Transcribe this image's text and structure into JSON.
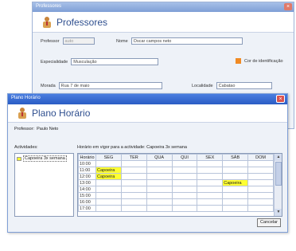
{
  "back_window": {
    "title": "Professores",
    "header_title": "Professores",
    "fields": {
      "professor_label": "Professor",
      "professor_value": "auto",
      "nome_label": "Nome",
      "nome_value": "Oscar campos neto",
      "especialidade_label": "Especialidade",
      "especialidade_value": "Musculação",
      "cor_label": "Cor de identificação",
      "morada_label": "Morada",
      "morada_value": "Rua 7 de maio",
      "localidade_label": "Localidade",
      "localidade_value": "Cabatao"
    },
    "colors": {
      "identification": "#f08a24"
    }
  },
  "front_window": {
    "title": "Plano Horário",
    "header_title": "Plano Horário",
    "professor_label": "Professor:",
    "professor_name": "Paulo Neto",
    "activities_label": "Actividades:",
    "schedule_label": "Horário em vigor para a actividade: Capoeira 3x semana",
    "activities": [
      {
        "name": "Capoeira 3x semana",
        "color": "#ffff33"
      }
    ],
    "columns": [
      "Horário",
      "SEG",
      "TER",
      "QUA",
      "QUI",
      "SEX",
      "SÁB",
      "DOM"
    ],
    "rows": [
      {
        "time": "10:00",
        "cells": [
          "",
          "",
          "",
          "",
          "",
          "",
          ""
        ]
      },
      {
        "time": "11:00",
        "cells": [
          "Capoeira",
          "",
          "",
          "",
          "",
          "",
          ""
        ]
      },
      {
        "time": "12:00",
        "cells": [
          "Capoeira",
          "",
          "",
          "",
          "",
          "",
          ""
        ]
      },
      {
        "time": "13:00",
        "cells": [
          "",
          "",
          "",
          "",
          "",
          "Capoeira",
          ""
        ]
      },
      {
        "time": "14:00",
        "cells": [
          "",
          "",
          "",
          "",
          "",
          "",
          ""
        ]
      },
      {
        "time": "15:00",
        "cells": [
          "",
          "",
          "",
          "",
          "",
          "",
          ""
        ]
      },
      {
        "time": "16:00",
        "cells": [
          "",
          "",
          "",
          "",
          "",
          "",
          ""
        ]
      },
      {
        "time": "17:00",
        "cells": [
          "",
          "",
          "",
          "",
          "",
          "",
          ""
        ]
      }
    ],
    "close_button": "Cancelar"
  }
}
